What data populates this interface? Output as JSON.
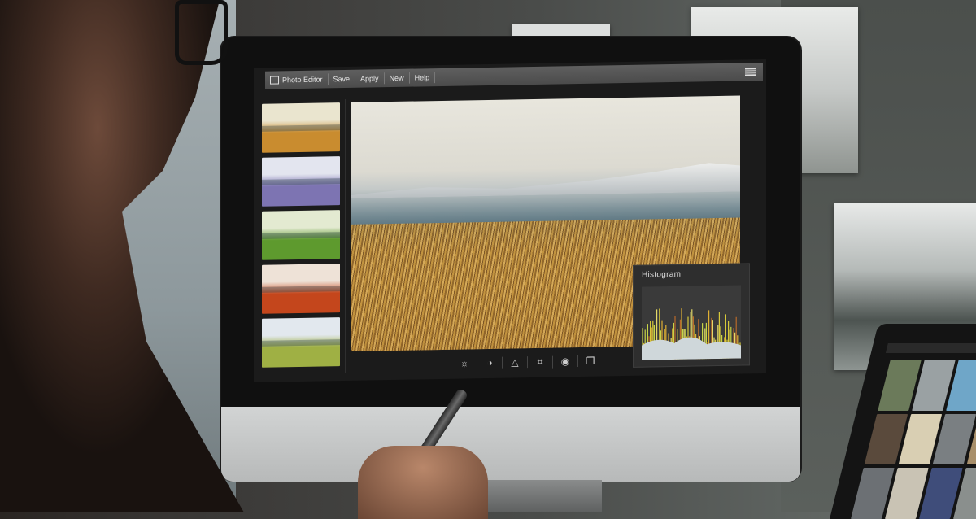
{
  "editor": {
    "app_title": "Photo Editor",
    "menu": [
      {
        "label": "Save"
      },
      {
        "label": "Apply"
      },
      {
        "label": "New"
      },
      {
        "label": "Help"
      }
    ],
    "menu_icon": "hamburger-menu-icon",
    "filter_thumbnails": [
      {
        "name": "warm-filter",
        "colors": [
          "#eae5cf",
          "#c98c2f"
        ]
      },
      {
        "name": "purple-filter",
        "colors": [
          "#e3e5ef",
          "#7d74b2"
        ]
      },
      {
        "name": "green-filter",
        "colors": [
          "#e3ead1",
          "#5e9a2e"
        ]
      },
      {
        "name": "red-filter",
        "colors": [
          "#eee2d7",
          "#c4461c"
        ]
      },
      {
        "name": "teal-filter",
        "colors": [
          "#e2e8ee",
          "#9fb044"
        ]
      }
    ],
    "toolbar": [
      {
        "icon": "brightness-icon",
        "glyph": "☼"
      },
      {
        "icon": "contrast-icon",
        "glyph": "◑"
      },
      {
        "icon": "sharpen-icon",
        "glyph": "△"
      },
      {
        "icon": "crop-icon",
        "glyph": "⌗"
      },
      {
        "icon": "preview-eye-icon",
        "glyph": "◉"
      },
      {
        "icon": "compare-icon",
        "glyph": "❐"
      }
    ],
    "histogram": {
      "title": "Histogram"
    }
  }
}
